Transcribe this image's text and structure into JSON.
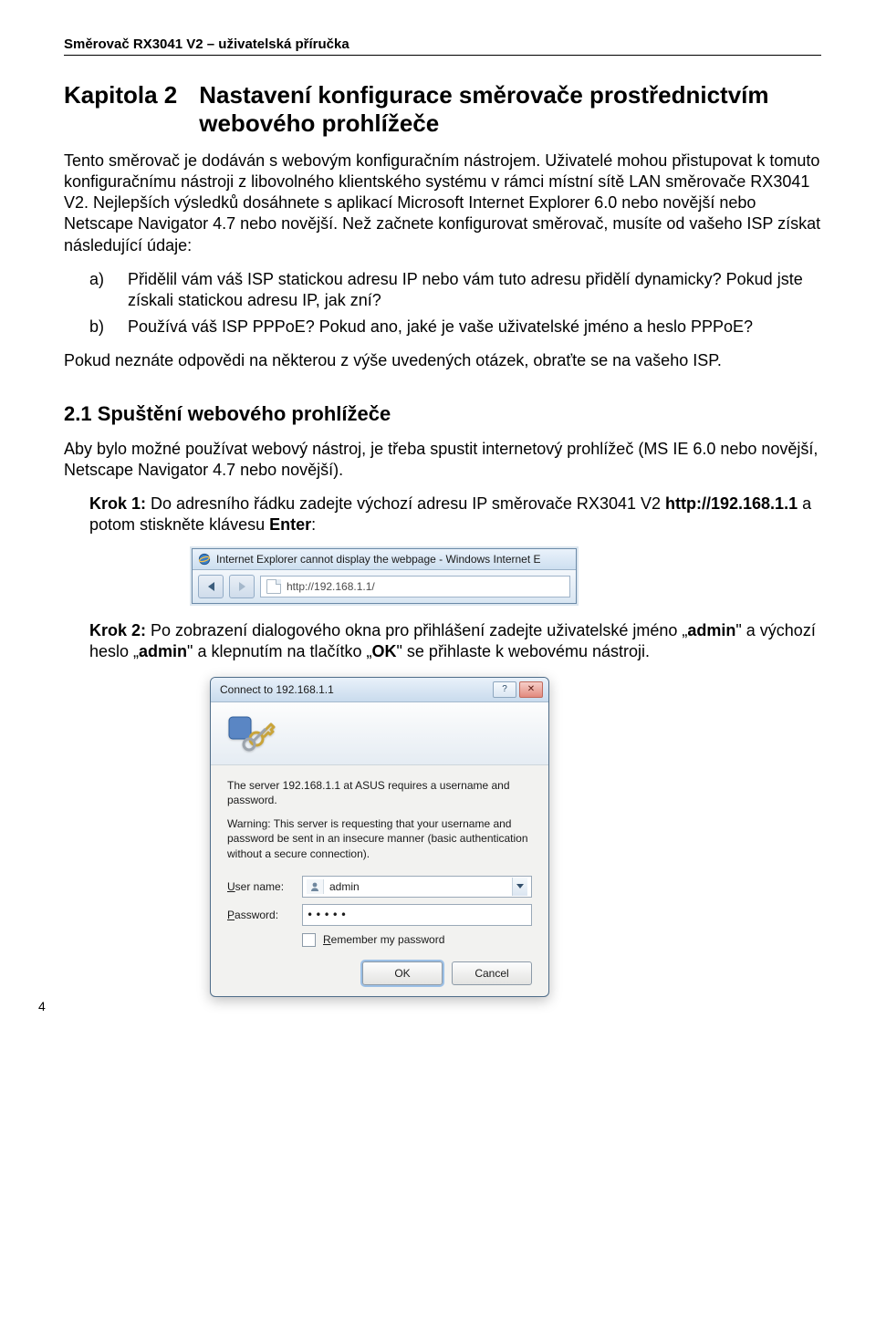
{
  "header": "Směrovač RX3041 V2 – uživatelská příručka",
  "chapter": {
    "label": "Kapitola 2",
    "title": "Nastavení konfigurace směrovače prostřednictvím webového prohlížeče"
  },
  "intro": "Tento směrovač je dodáván s webovým konfiguračním nástrojem. Uživatelé mohou přistupovat k tomuto konfiguračnímu nástroji z libovolného klientského systému v rámci místní sítě LAN směrovače RX3041 V2. Nejlepších výsledků dosáhnete s aplikací Microsoft Internet Explorer 6.0 nebo novější nebo Netscape Navigator 4.7 nebo novější. Než začnete konfigurovat směrovač, musíte od vašeho ISP získat následující údaje:",
  "list": {
    "a_marker": "a)",
    "a_text": "Přidělil vám váš ISP statickou adresu IP nebo vám tuto adresu přidělí dynamicky? Pokud jste získali statickou adresu IP, jak zní?",
    "b_marker": "b)",
    "b_text": "Používá váš ISP PPPoE? Pokud ano, jaké je vaše uživatelské jméno a heslo PPPoE?"
  },
  "after_list": "Pokud neznáte odpovědi na některou z výše uvedených otázek, obraťte se na vašeho ISP.",
  "section21_heading": "2.1 Spuštění webového prohlížeče",
  "section21_body": "Aby bylo možné používat webový nástroj, je třeba spustit internetový prohlížeč (MS IE 6.0 nebo novější, Netscape Navigator 4.7 nebo novější).",
  "step1": {
    "label": "Krok 1:",
    "part1": " Do adresního řádku zadejte výchozí adresu IP směrovače RX3041 V2 ",
    "url": "http://192.168.1.1",
    "part2": " a potom stiskněte klávesu ",
    "enter": "Enter",
    "part3": ":"
  },
  "ie": {
    "title": "Internet Explorer cannot display the webpage - Windows Internet E",
    "url": "http://192.168.1.1/"
  },
  "step2": {
    "label": "Krok 2:",
    "part1": " Po zobrazení dialogového okna pro přihlášení zadejte uživatelské jméno „",
    "admin1": "admin",
    "part2": "\" a výchozí heslo „",
    "admin2": "admin",
    "part3": "\" a klepnutím na tlačítko „",
    "ok": "OK",
    "part4": "\" se přihlaste k webovému nástroji."
  },
  "dialog": {
    "title": "Connect to 192.168.1.1",
    "msg": "The server 192.168.1.1 at ASUS requires a username and password.",
    "warn": "Warning: This server is requesting that your username and password be sent in an insecure manner (basic authentication without a secure connection).",
    "user_label_pre": "U",
    "user_label_rest": "ser name:",
    "user_value": "admin",
    "pass_label_pre": "P",
    "pass_label_rest": "assword:",
    "pass_value": "•••••",
    "remember_pre": "R",
    "remember_rest": "emember my password",
    "ok": "OK",
    "cancel": "Cancel",
    "help_glyph": "?",
    "close_glyph": "✕"
  },
  "page_num": "4"
}
